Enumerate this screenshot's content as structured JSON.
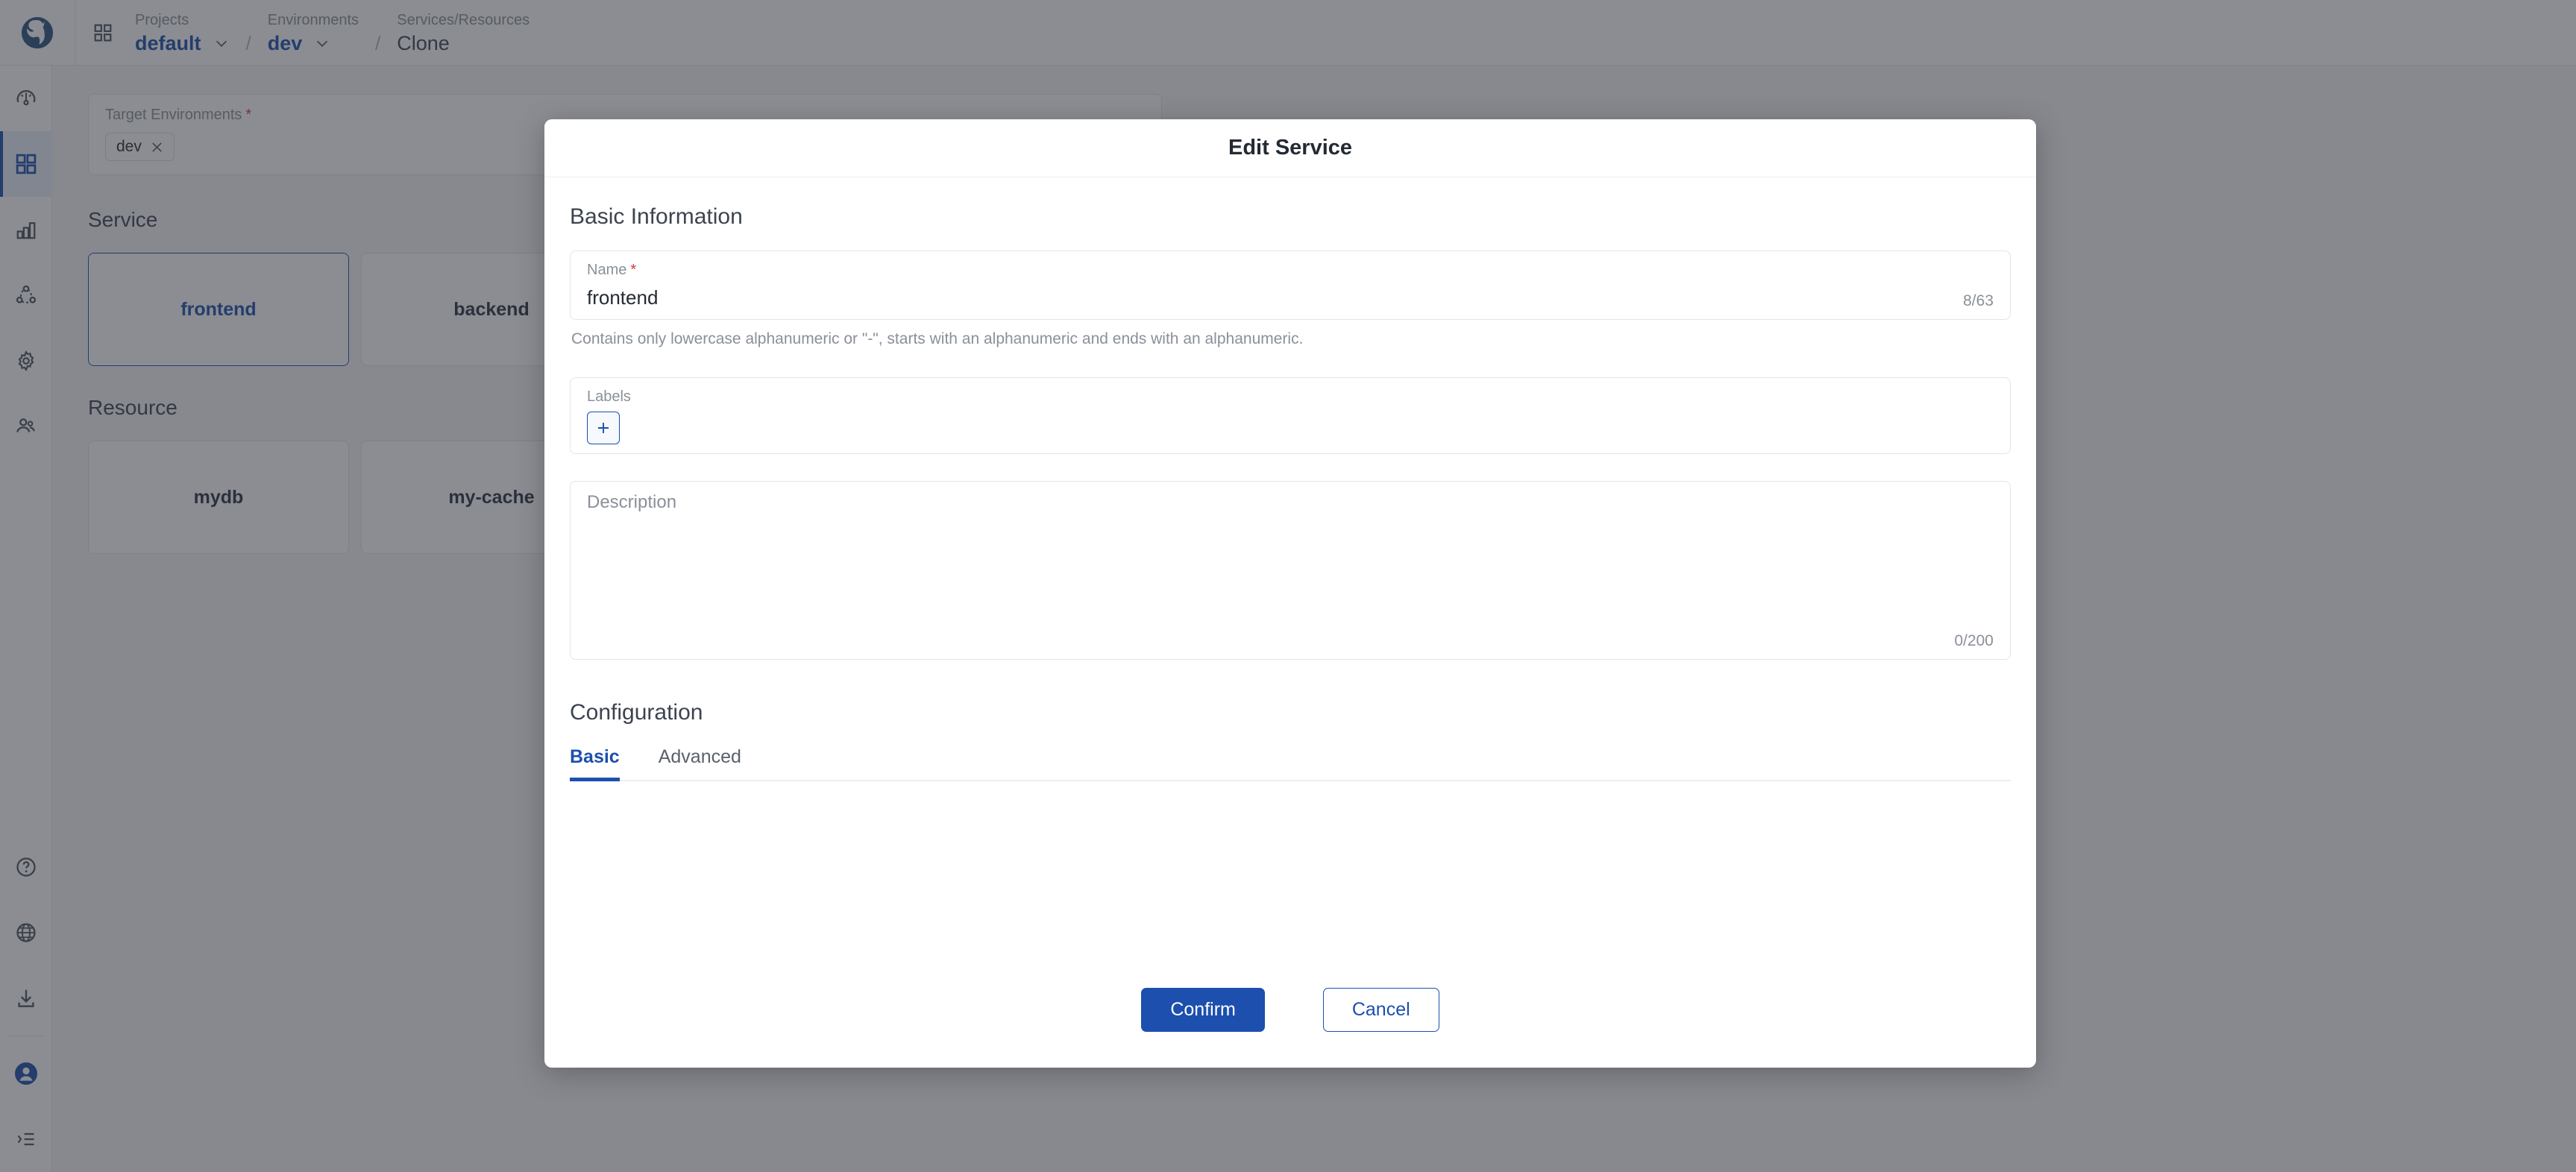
{
  "header": {
    "logo_icon": "whale-logo",
    "apps_icon": "grid-apps-icon",
    "breadcrumbs": [
      {
        "label": "Projects",
        "value": "default",
        "has_chevron": true,
        "accent": true
      },
      {
        "label": "Environments",
        "value": "dev",
        "has_chevron": true,
        "accent": true
      },
      {
        "label": "Services/Resources",
        "value": "Clone",
        "has_chevron": false,
        "accent": false
      }
    ],
    "separator": "/"
  },
  "sidebar": {
    "items": [
      {
        "name": "dashboard",
        "icon": "gauge-icon",
        "active": false
      },
      {
        "name": "applications",
        "icon": "grid-icon",
        "active": true
      },
      {
        "name": "monitoring",
        "icon": "bar-chart-icon",
        "active": false
      },
      {
        "name": "topology",
        "icon": "network-icon",
        "active": false
      },
      {
        "name": "settings",
        "icon": "gear-icon",
        "active": false
      },
      {
        "name": "users",
        "icon": "users-icon",
        "active": false
      }
    ],
    "bottom_items": [
      {
        "name": "help",
        "icon": "question-circle-icon"
      },
      {
        "name": "language",
        "icon": "globe-icon"
      },
      {
        "name": "download",
        "icon": "download-icon"
      },
      {
        "name": "account",
        "icon": "user-avatar-icon"
      },
      {
        "name": "collapse",
        "icon": "list-collapse-icon"
      }
    ]
  },
  "background_page": {
    "target_environments": {
      "label": "Target Environments",
      "required_marker": "*",
      "tags": [
        {
          "text": "dev",
          "remove_icon": "close-icon"
        }
      ]
    },
    "service_section": {
      "title": "Service",
      "cards": [
        {
          "name": "frontend",
          "selected": true
        },
        {
          "name": "backend",
          "selected": false
        }
      ]
    },
    "resource_section": {
      "title": "Resource",
      "cards": [
        {
          "name": "mydb",
          "selected": false
        },
        {
          "name": "my-cache",
          "selected": false
        }
      ]
    }
  },
  "modal": {
    "title": "Edit Service",
    "basic_information": {
      "heading": "Basic Information",
      "name_field": {
        "label": "Name",
        "required_marker": "*",
        "value": "frontend",
        "counter": "8/63",
        "hint": "Contains only lowercase alphanumeric or \"-\", starts with an alphanumeric and ends with an alphanumeric."
      },
      "labels_field": {
        "label": "Labels",
        "add_icon": "plus-icon"
      },
      "description_field": {
        "placeholder": "Description",
        "value": "",
        "counter": "0/200"
      }
    },
    "configuration": {
      "heading": "Configuration",
      "tabs": [
        {
          "label": "Basic",
          "active": true
        },
        {
          "label": "Advanced",
          "active": false
        }
      ]
    },
    "footer": {
      "confirm_label": "Confirm",
      "cancel_label": "Cancel"
    }
  },
  "colors": {
    "accent": "#1c4fae",
    "required": "#d0393e",
    "muted": "#8a9099",
    "text": "#242a33"
  }
}
